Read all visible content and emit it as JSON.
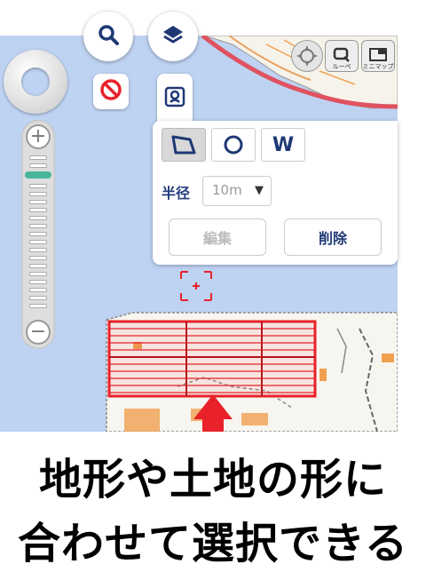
{
  "toolbar": {
    "search_icon": "search-icon",
    "layers_icon": "layers-icon",
    "no_entry_icon": "no-entry-icon",
    "location_icon": "location-pin-icon"
  },
  "map_controls": {
    "loupe_label": "ルーペ",
    "minimap_label": "ミニマップ"
  },
  "draw_panel": {
    "shapes": [
      "polygon",
      "circle",
      "W"
    ],
    "radius_label": "半径",
    "radius_value": "10m",
    "edit_label": "編集",
    "delete_label": "削除"
  },
  "caption": {
    "line1": "地形や土地の形に",
    "line2": "合わせて選択できる"
  },
  "colors": {
    "map_water": "#bed2f2",
    "selection_red": "#e8212a",
    "panel_text": "#223a7a"
  }
}
